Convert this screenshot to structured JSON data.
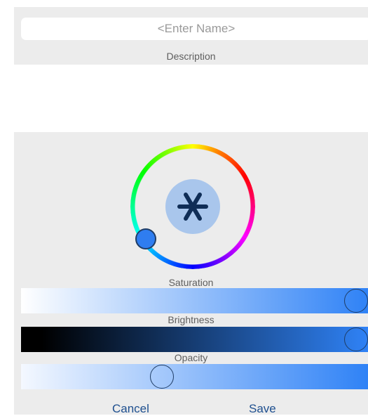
{
  "name_field": {
    "placeholder": "<Enter Name>",
    "value": ""
  },
  "description": {
    "label": "Description",
    "value": ""
  },
  "color_wheel": {
    "hue_knob_color": "#2f7df0",
    "swatch_color": "#a9c6ec"
  },
  "sliders": {
    "saturation": {
      "label": "Saturation",
      "value": 1.0
    },
    "brightness": {
      "label": "Brightness",
      "value": 1.0
    },
    "opacity": {
      "label": "Opacity",
      "value": 0.4
    }
  },
  "buttons": {
    "cancel_label": "Cancel",
    "save_label": "Save"
  },
  "colors": {
    "accent": "#2f82f6",
    "button_text": "#1e4f8f"
  }
}
